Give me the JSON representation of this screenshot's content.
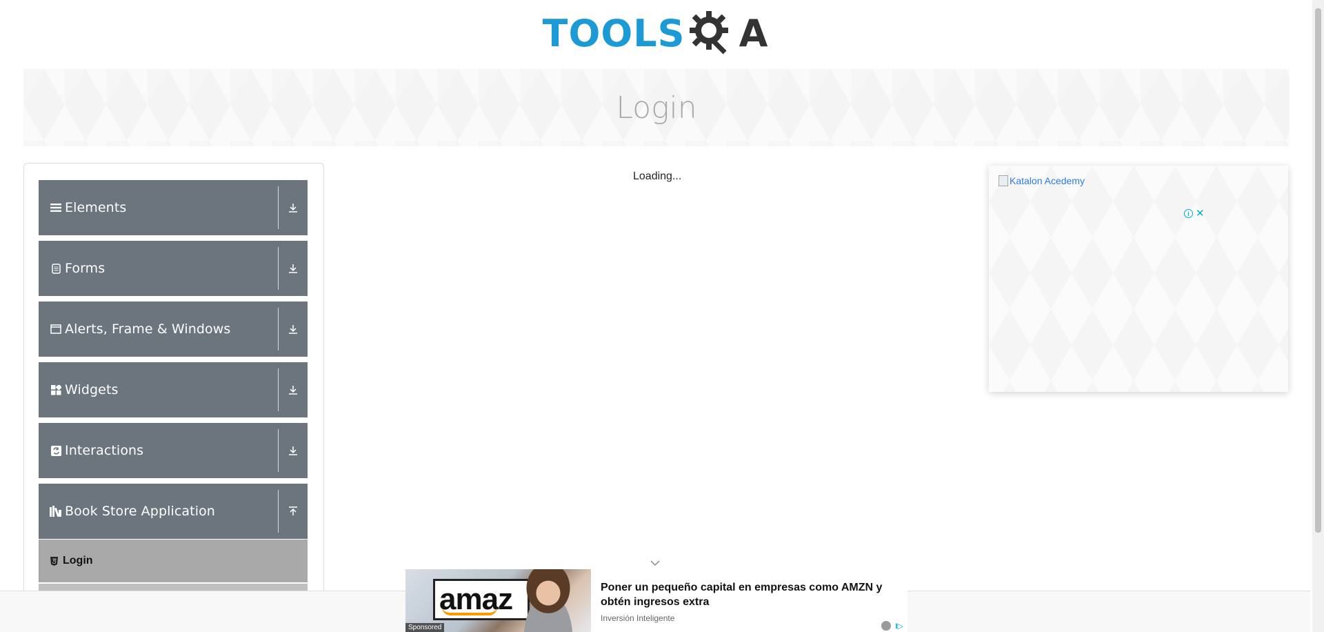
{
  "header": {
    "logo_blue": "TOOLS",
    "logo_dark": "A",
    "logo_icon": "gear-magnifier-icon"
  },
  "banner": {
    "title": "Login"
  },
  "sidebar": {
    "groups": [
      {
        "label": "Elements",
        "icon": "list-icon",
        "arrow": "expand-down-icon"
      },
      {
        "label": "Forms",
        "icon": "document-icon",
        "arrow": "expand-down-icon"
      },
      {
        "label": "Alerts, Frame & Windows",
        "icon": "window-icon",
        "arrow": "expand-down-icon"
      },
      {
        "label": "Widgets",
        "icon": "widgets-icon",
        "arrow": "expand-down-icon"
      },
      {
        "label": "Interactions",
        "icon": "refresh-icon",
        "arrow": "expand-down-icon"
      },
      {
        "label": "Book Store Application",
        "icon": "books-icon",
        "arrow": "collapse-up-icon"
      }
    ],
    "sub_items": [
      {
        "label": "Login",
        "icon": "html5-icon"
      }
    ]
  },
  "main": {
    "loading_text": "Loading..."
  },
  "right_ad": {
    "image_alt": "Katalon Acedemy",
    "info_icon": "info-icon",
    "close_icon": "close-icon"
  },
  "bottom_ad": {
    "image_text": "amaz",
    "sponsored": "Sponsored",
    "headline": "Poner un pequeño capital en empresas como AMZN y obtén ingresos extra",
    "source": "Inversión Inteligente",
    "ad_badge": "I▷"
  },
  "colors": {
    "sidebar_group_bg": "#6c757d",
    "sidebar_active_bg": "#a9a9a9",
    "logo_blue": "#1c9ad6",
    "logo_dark": "#333333",
    "ad_accent": "#00aecd"
  }
}
